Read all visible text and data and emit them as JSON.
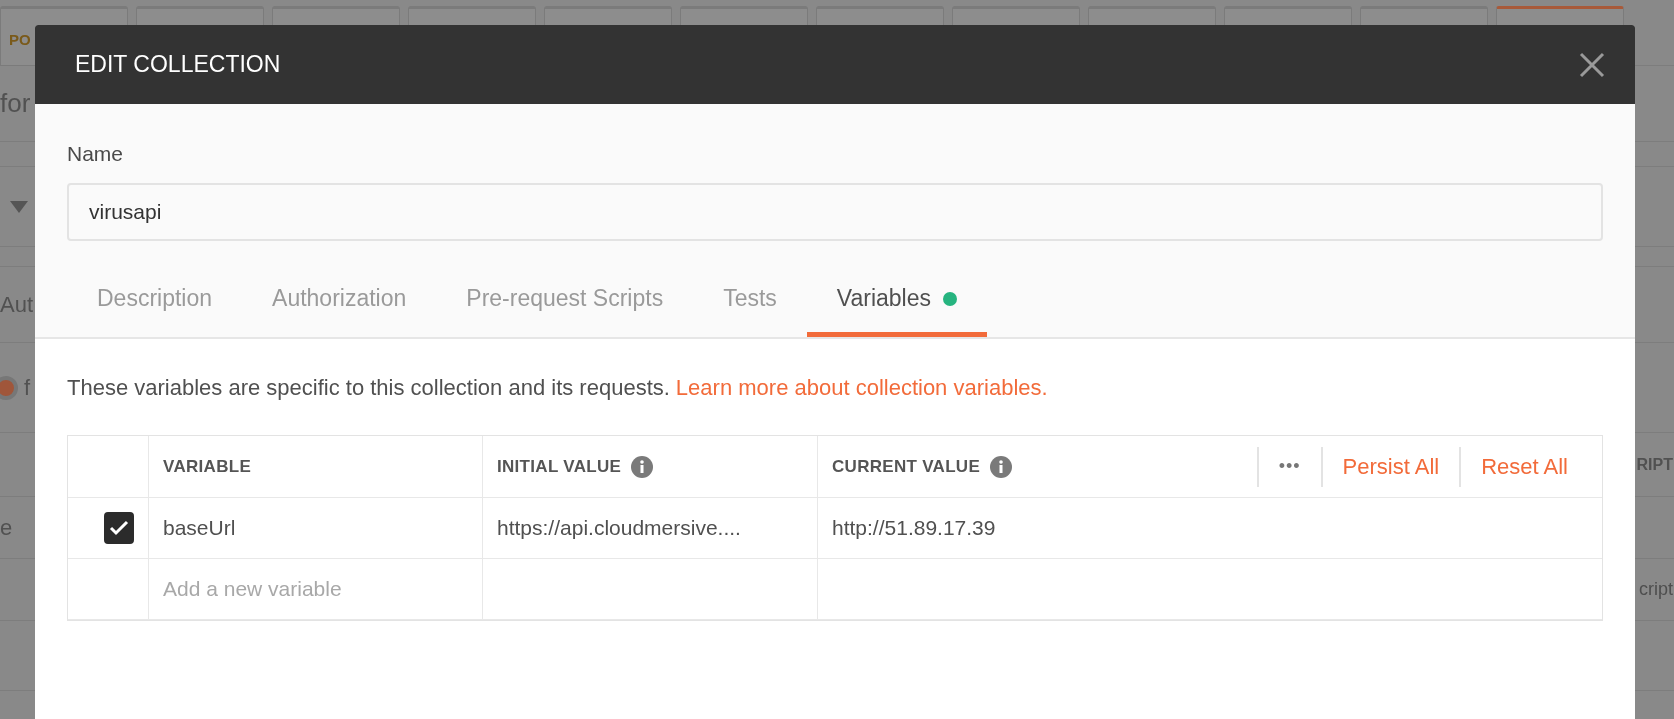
{
  "background": {
    "tabs": [
      {
        "label": "PO",
        "selected": false
      },
      {
        "selected": false
      },
      {
        "selected": false
      },
      {
        "selected": false
      },
      {
        "selected": false
      },
      {
        "selected": false
      },
      {
        "selected": false
      },
      {
        "selected": false
      },
      {
        "selected": false
      },
      {
        "selected": false
      },
      {
        "selected": false
      },
      {
        "selected": true
      }
    ],
    "title_fragment": "for",
    "auth_fragment": "Aut",
    "radio_selected": true,
    "radio_label_fragment": "f",
    "row_fragment": "e",
    "header_fragment": "RIPT",
    "placeholder_fragment": "cript"
  },
  "dialog": {
    "title": "EDIT COLLECTION",
    "name_label": "Name",
    "name_value": "virusapi",
    "tabs": [
      {
        "label": "Description",
        "selected": false,
        "dot": false
      },
      {
        "label": "Authorization",
        "selected": false,
        "dot": false
      },
      {
        "label": "Pre-request Scripts",
        "selected": false,
        "dot": false
      },
      {
        "label": "Tests",
        "selected": false,
        "dot": false
      },
      {
        "label": "Variables",
        "selected": true,
        "dot": true
      }
    ],
    "description": "These variables are specific to this collection and its requests.",
    "learn_more_link": "Learn more about collection variables.",
    "table": {
      "columns": [
        {
          "label": "VARIABLE",
          "info": false
        },
        {
          "label": "INITIAL VALUE",
          "info": true
        },
        {
          "label": "CURRENT VALUE",
          "info": true
        }
      ],
      "menu": "•••",
      "actions": [
        "Persist All",
        "Reset All"
      ],
      "rows": [
        {
          "checked": true,
          "variable": "baseUrl",
          "initial_value": "https://api.cloudmersive....",
          "current_value": "http://51.89.17.39"
        }
      ],
      "new_row_placeholder": "Add a new variable"
    }
  }
}
